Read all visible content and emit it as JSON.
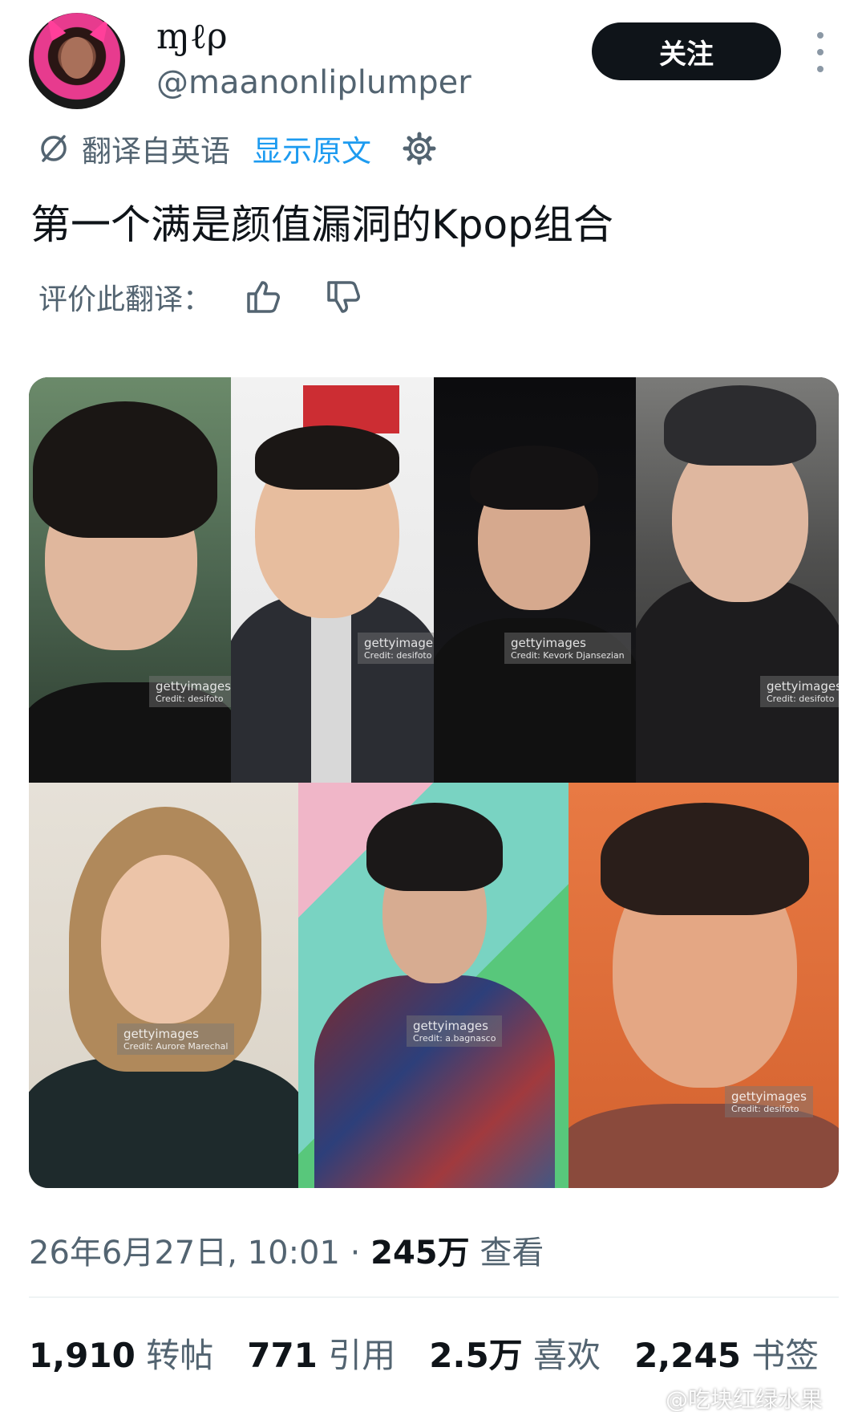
{
  "user": {
    "display_name": "ɱℓρ",
    "handle": "@maanonliplumper",
    "avatar_icon": "avatar"
  },
  "actions": {
    "follow_label": "关注",
    "more_icon": "more-vertical-icon"
  },
  "translation": {
    "translated_from": "翻译自英语",
    "show_original": "显示原文",
    "settings_icon": "gear-icon",
    "rate_label": "评价此翻译："
  },
  "tweet": {
    "text": "第一个满是颜值漏洞的Kpop组合"
  },
  "media": {
    "watermarks": [
      [
        "gettyimages",
        "Credit: desifoto"
      ],
      [
        "gettyimages",
        "Credit: desifoto"
      ],
      [
        "gettyimages",
        "Credit: Kevork Djansezian"
      ],
      [
        "gettyimages",
        "Credit: desifoto"
      ],
      [
        "gettyimages",
        "Credit: Aurore Marechal"
      ],
      [
        "gettyimages",
        "Credit: a.bagnasco"
      ],
      [
        "gettyimages",
        "Credit: desifoto"
      ]
    ]
  },
  "meta": {
    "datetime": "26年6月27日, 10:01",
    "separator": "·",
    "views_count": "245万",
    "views_label": "查看"
  },
  "stats": [
    {
      "num": "1,910",
      "label": "转帖"
    },
    {
      "num": "771",
      "label": "引用"
    },
    {
      "num": "2.5万",
      "label": "喜欢"
    },
    {
      "num": "2,245",
      "label": "书签"
    }
  ],
  "source_watermark": "@吃块红绿水果",
  "colors": {
    "accent": "#1d9bf0",
    "text_primary": "#0f1419",
    "text_secondary": "#536471"
  }
}
